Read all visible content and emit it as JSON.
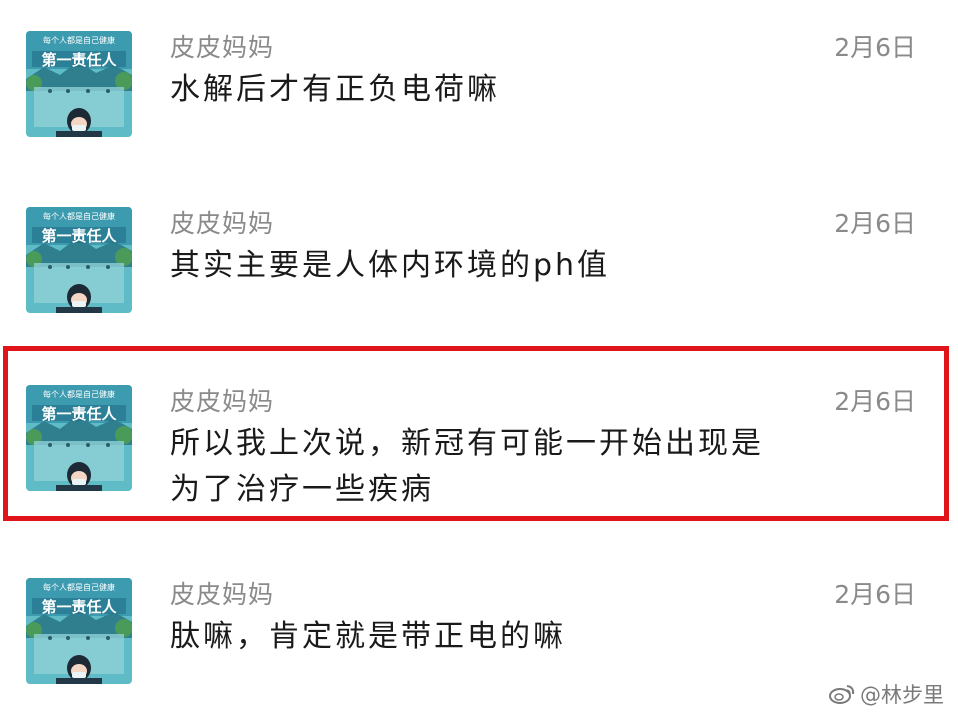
{
  "comments": [
    {
      "username": "皮皮妈妈",
      "timestamp": "2月6日",
      "text": "水解后才有正负电荷嘛",
      "avatar": "avatar-image",
      "highlighted": false
    },
    {
      "username": "皮皮妈妈",
      "timestamp": "2月6日",
      "text": "其实主要是人体内环境的ph值",
      "avatar": "avatar-image",
      "highlighted": false
    },
    {
      "username": "皮皮妈妈",
      "timestamp": "2月6日",
      "text": "所以我上次说，新冠有可能一开始出现是\n为了治疗一些疾病",
      "avatar": "avatar-image",
      "highlighted": true
    },
    {
      "username": "皮皮妈妈",
      "timestamp": "2月6日",
      "text": "肽嘛，肯定就是带正电的嘛",
      "avatar": "avatar-image",
      "highlighted": false
    }
  ],
  "avatar_text": {
    "small": "每个人都是自己健康",
    "big": "第一责任人"
  },
  "highlight_color": "#e0141b",
  "watermark": {
    "icon": "weibo-icon",
    "text": "@林步里"
  }
}
